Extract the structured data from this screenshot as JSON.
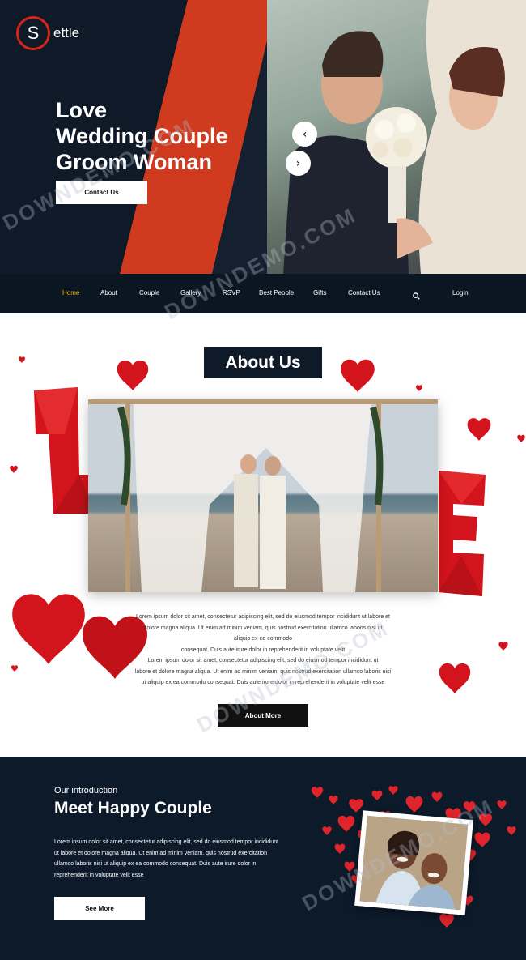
{
  "header": {
    "logo_letter": "S",
    "logo_text": "ettle",
    "hero_title_lines": [
      "Love",
      "Wedding Couple",
      "Groom Woman"
    ],
    "contact_button": "Contact Us",
    "prev_arrow": "‹",
    "next_arrow": "›"
  },
  "nav": {
    "items": [
      {
        "label": "Home",
        "active": true
      },
      {
        "label": "About",
        "active": false
      },
      {
        "label": "Couple",
        "active": false
      },
      {
        "label": "Gallery",
        "active": false
      },
      {
        "label": "RSVP",
        "active": false
      },
      {
        "label": "Best People",
        "active": false
      },
      {
        "label": "Gifts",
        "active": false
      },
      {
        "label": "Contact Us",
        "active": false
      }
    ],
    "search_icon": "search-icon",
    "login_label": "Login"
  },
  "about": {
    "title": "About Us",
    "paragraph_lines": [
      "Lorem ipsum dolor sit amet, consectetur adipiscing elit, sed do eiusmod tempor incididunt ut labore et",
      "dolore magna aliqua. Ut enim ad minim veniam, quis nostrud exercitation ullamco laboris nisi ut",
      "aliquip ex ea commodo",
      "consequat. Duis aute irure dolor in reprehenderit in voluptate velit",
      "Lorem ipsum dolor sit amet, consectetur adipiscing elit, sed do eiusmod tempor incididunt ut",
      "labore et dolore magna aliqua. Ut enim ad minim veniam, quis nostrud exercitation ullamco laboris nisi",
      "ut aliquip ex ea commodo consequat. Duis aute irure dolor in reprehenderit in voluptate velit esse"
    ],
    "button": "About More"
  },
  "intro": {
    "kicker": "Our introduction",
    "title": "Meet Happy Couple",
    "paragraph_lines": [
      "Lorem ipsum dolor sit amet, consectetur adipiscing elit, sed do eiusmod tempor incididunt",
      "ut labore et dolore magna aliqua. Ut enim ad minim veniam, quis nostrud exercitation",
      "ullamco laboris nisi ut aliquip ex ea commodo consequat. Duis aute irure dolor in",
      "reprehenderit in voluptate velit esse"
    ],
    "button": "See More"
  },
  "colors": {
    "navy": "#0f1a28",
    "accent_red": "#d8251b",
    "heart_red": "#d4141c",
    "nav_active": "#f2b705"
  },
  "watermark": "DOWNDEMO.COM"
}
